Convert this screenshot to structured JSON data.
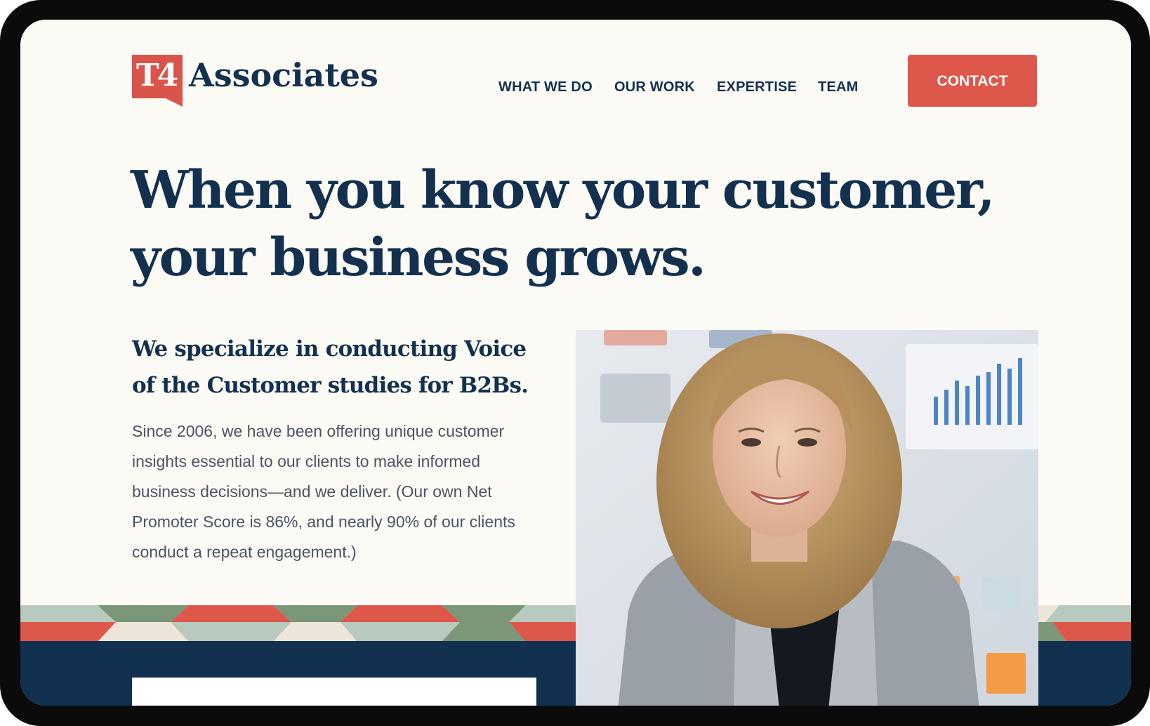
{
  "brand": {
    "logo_mark": "T4",
    "logo_word": "Associates",
    "primary_color": "#13314f",
    "accent_color": "#dd574b"
  },
  "nav": {
    "items": [
      {
        "label": "WHAT WE DO"
      },
      {
        "label": "OUR WORK"
      },
      {
        "label": "EXPERTISE"
      },
      {
        "label": "TEAM"
      }
    ],
    "contact_label": "CONTACT"
  },
  "hero": {
    "headline_line1": "When you know your customer,",
    "headline_line2": "your business grows.",
    "subhead": "We specialize in conducting Voice of the Customer studies for B2Bs.",
    "body": "Since 2006, we have been offering unique customer insights essential to our clients to make informed business decisions—and we deliver. (Our own Net Promoter Score is 86%, and nearly 90% of our clients conduct a repeat engagement.)"
  }
}
